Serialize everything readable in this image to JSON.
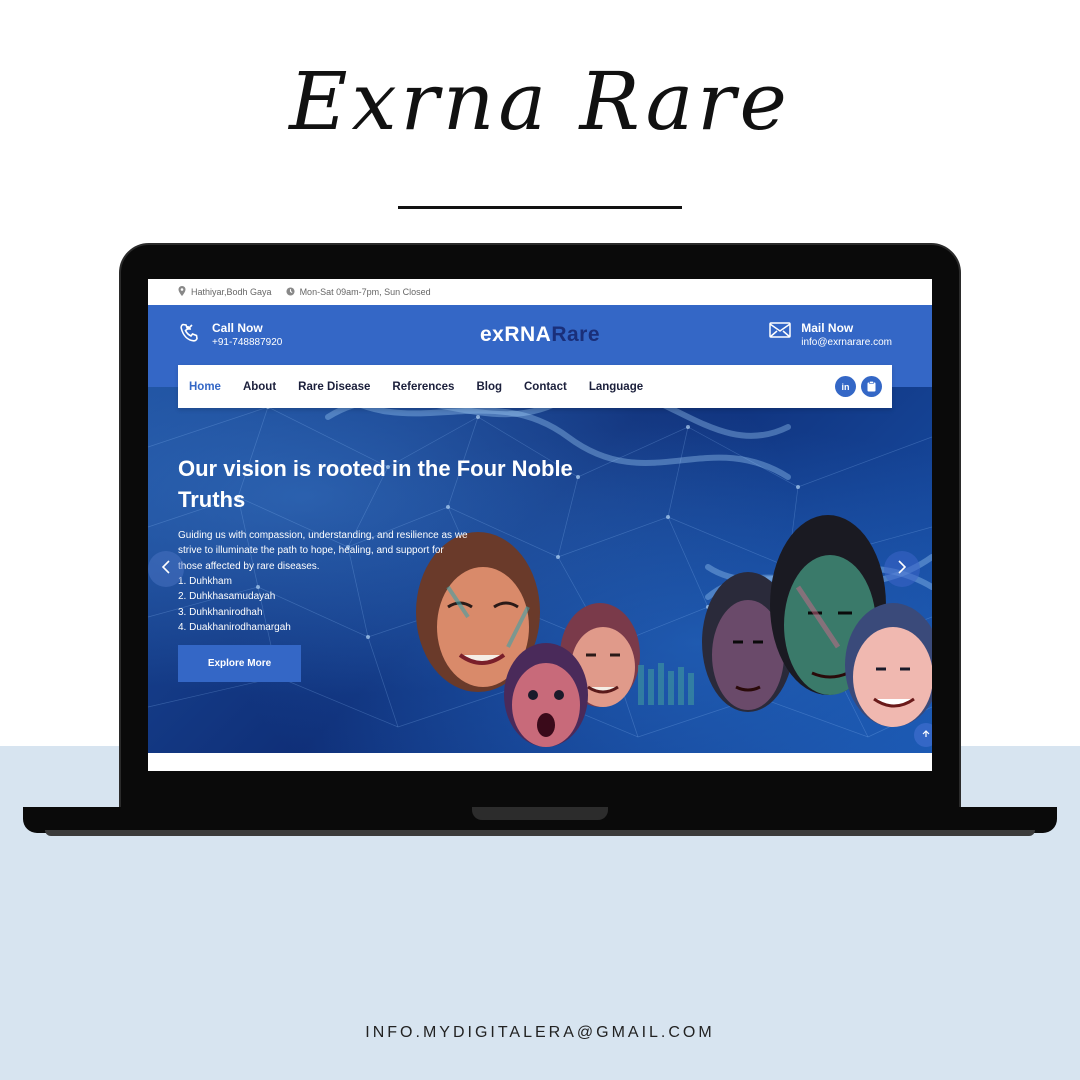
{
  "page": {
    "script_title": "Exrna Rare",
    "footer_email": "INFO.MYDIGITALERA@GMAIL.COM"
  },
  "website": {
    "topbar": {
      "location": "Hathiyar,Bodh Gaya",
      "hours": "Mon-Sat 09am-7pm, Sun Closed"
    },
    "header": {
      "call_label": "Call Now",
      "call_number": "+91-748887920",
      "logo_part1": "exRNA",
      "logo_part2": "Rare",
      "mail_label": "Mail Now",
      "mail_address": "info@exrnarare.com"
    },
    "nav": {
      "items": [
        "Home",
        "About",
        "Rare Disease",
        "References",
        "Blog",
        "Contact",
        "Language"
      ],
      "active": "Home",
      "social_linkedin": "in"
    },
    "hero": {
      "title": "Our vision is rooted in the Four Noble Truths",
      "description": "Guiding us with compassion, understanding, and resilience as we strive to illuminate the path to hope, healing, and support for those affected by rare diseases.",
      "list": [
        "1. Duhkham",
        "2. Duhkhasamudayah",
        "3. Duhkhanirodhah",
        "4. Duakhanirodhamargah"
      ],
      "cta": "Explore More"
    },
    "icons": {
      "location": "map-pin-icon",
      "clock": "clock-icon",
      "phone": "phone-icon",
      "mail": "envelope-icon",
      "linkedin": "linkedin-icon",
      "clipboard": "clipboard-icon",
      "prev": "chevron-left-icon",
      "next": "chevron-right-icon",
      "scroll_top": "arrow-up-icon"
    },
    "colors": {
      "brand_blue": "#3467c6",
      "logo_dark": "#1a2f7a",
      "background_band": "#d7e4f0"
    }
  }
}
